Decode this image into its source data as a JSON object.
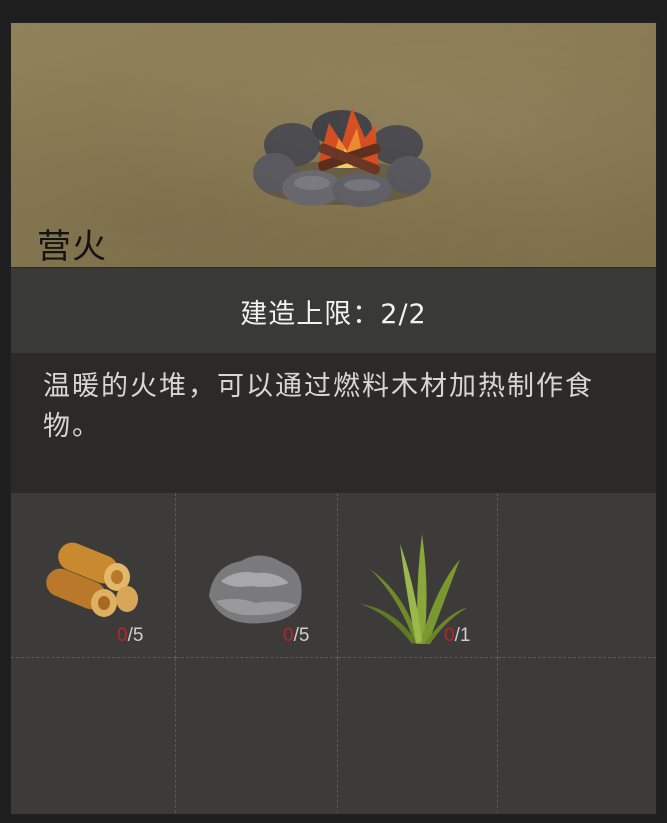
{
  "item": {
    "title": "营火",
    "icon": "campfire-icon"
  },
  "build_limit": {
    "text": "建造上限：2/2"
  },
  "description": {
    "text": "温暖的火堆，可以通过燃料木材加热制作食物。"
  },
  "materials": [
    {
      "icon": "wood-log-icon",
      "have": "0",
      "need": "/5"
    },
    {
      "icon": "stone-icon",
      "have": "0",
      "need": "/5"
    },
    {
      "icon": "grass-icon",
      "have": "0",
      "need": "/1"
    }
  ],
  "colors": {
    "banner": "#8a7b53",
    "panel": "#3a3938",
    "insufficient": "#b5262a"
  }
}
